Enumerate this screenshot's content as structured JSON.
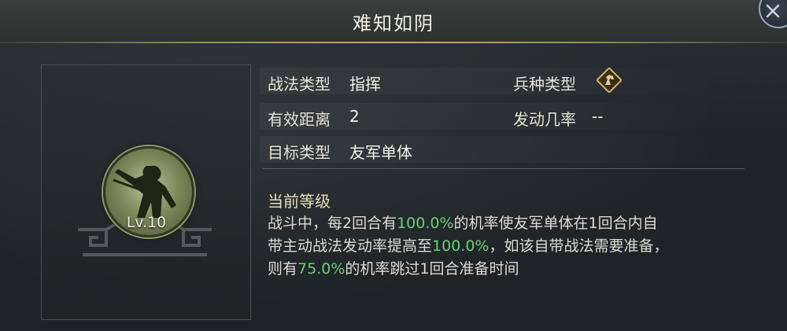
{
  "title": "难知如阴",
  "portrait": {
    "level": "Lv.10"
  },
  "info": {
    "tactic_type_label": "战法类型",
    "tactic_type_value": "指挥",
    "range_label": "有效距离",
    "range_value": "2",
    "target_label": "目标类型",
    "target_value": "友军单体",
    "unit_type_label": "兵种类型",
    "unit_type_icon": "cavalry-horse-icon",
    "trigger_rate_label": "发动几率",
    "trigger_rate_value": "--"
  },
  "description": {
    "section_title": "当前等级",
    "line1_a": "战斗中，每2回合有",
    "line1_hl": "100.0%",
    "line1_b": "的机率使友军单体在1回合内自",
    "line2_a": "带主动战法发动率提高至",
    "line2_hl": "100.0%",
    "line2_b": "，如该自带战法需要准备，",
    "line3_a": "则有",
    "line3_hl": "75.0%",
    "line3_b": "的机率跳过1回合准备时间"
  },
  "colors": {
    "highlight": "#6fce73",
    "gold_accent": "#c2ad74"
  }
}
